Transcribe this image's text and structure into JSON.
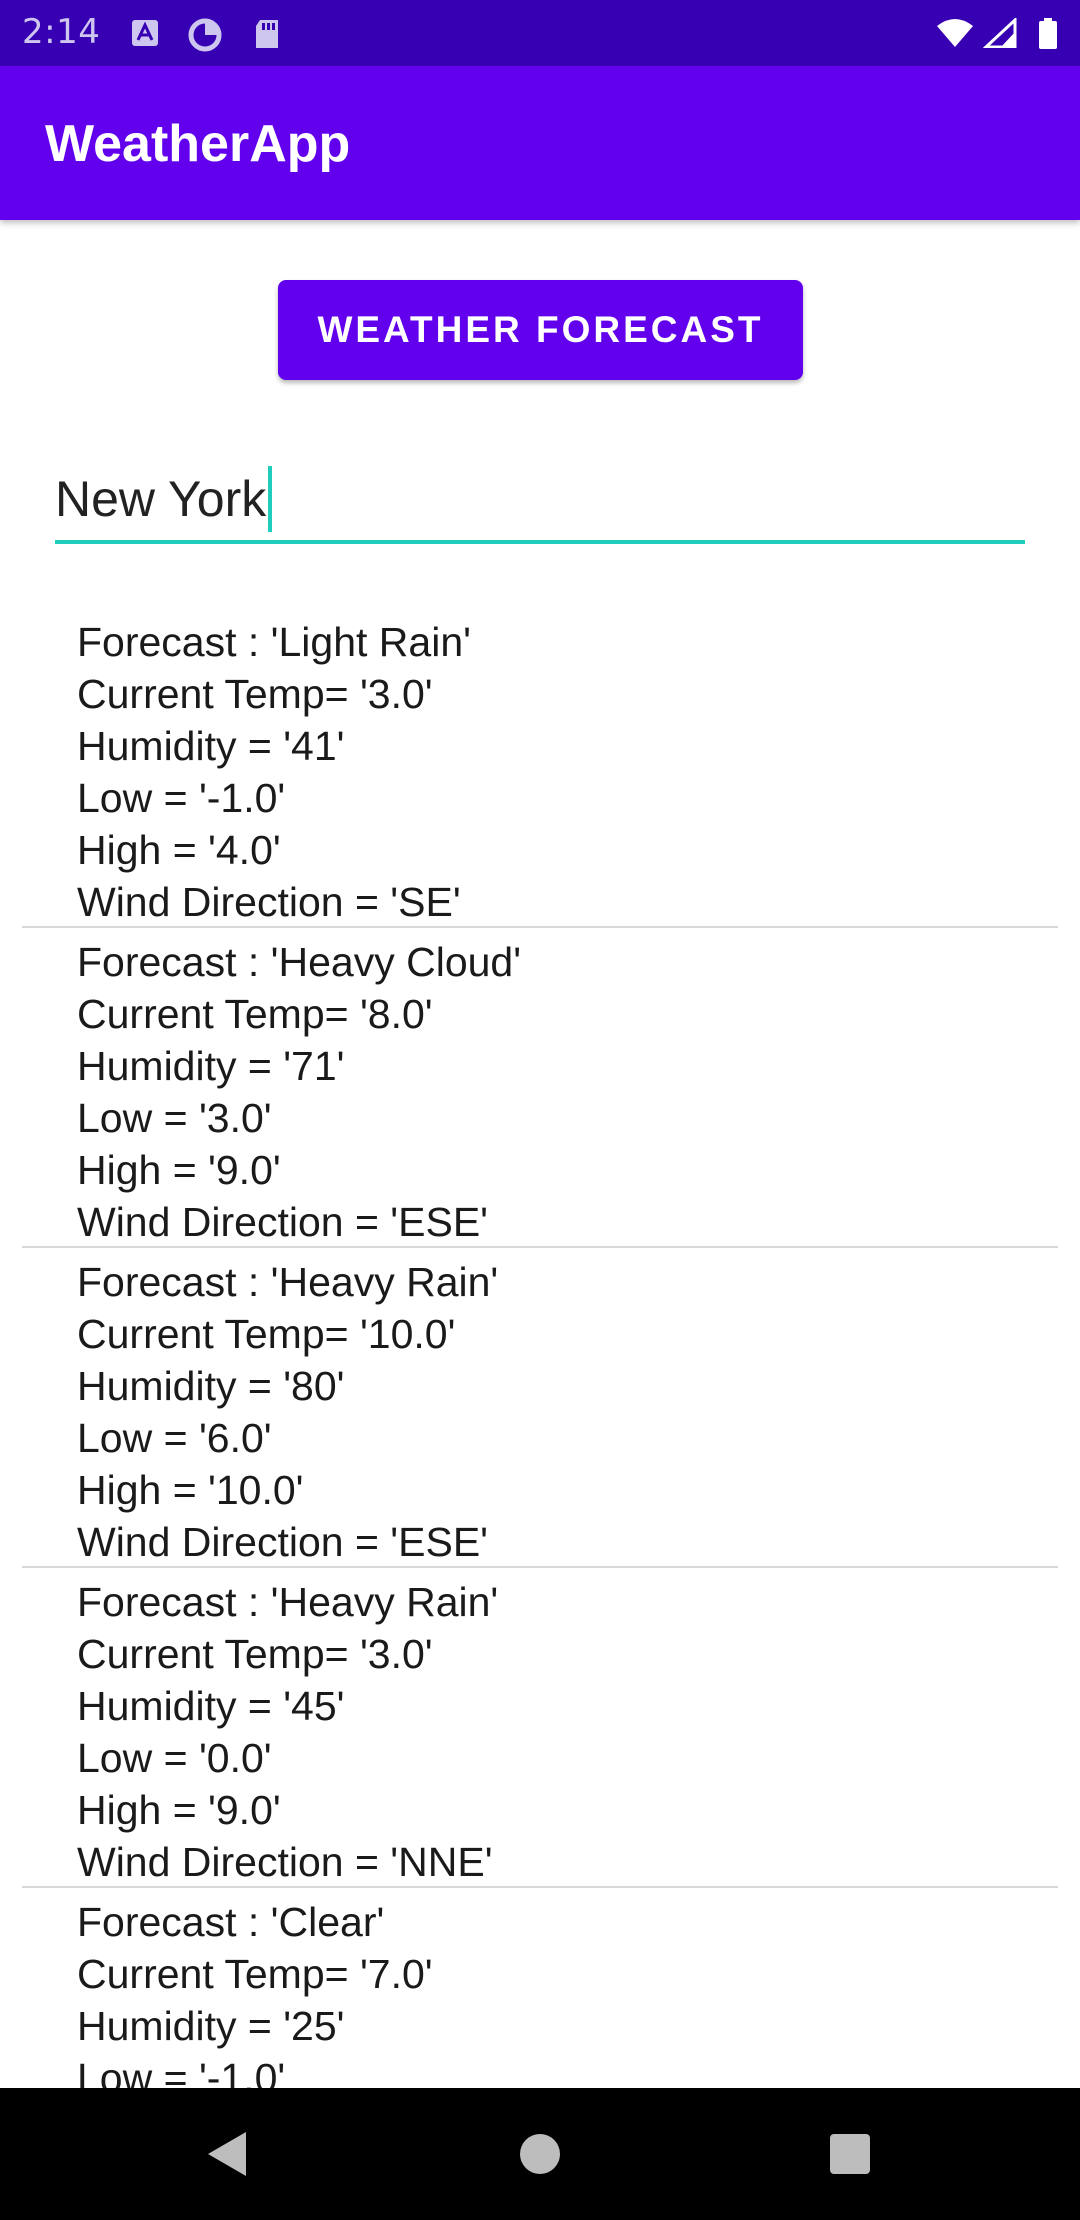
{
  "status_bar": {
    "time": "2:14",
    "icons": [
      "autofill-icon",
      "data-saver-icon",
      "sd-card-icon",
      "wifi-icon",
      "signal-icon",
      "battery-icon"
    ]
  },
  "app_bar": {
    "title": "WeatherApp"
  },
  "forecast_button": {
    "label": "WEATHER FORECAST"
  },
  "city_input": {
    "value": "New York"
  },
  "forecasts": [
    {
      "forecast": "Forecast : 'Light Rain'",
      "current_temp": "Current Temp= '3.0'",
      "humidity": "Humidity = '41'",
      "low": "Low = '-1.0'",
      "high": "High = '4.0'",
      "wind": "Wind Direction = 'SE'"
    },
    {
      "forecast": "Forecast : 'Heavy Cloud'",
      "current_temp": "Current Temp= '8.0'",
      "humidity": "Humidity = '71'",
      "low": "Low = '3.0'",
      "high": "High = '9.0'",
      "wind": "Wind Direction = 'ESE'"
    },
    {
      "forecast": "Forecast : 'Heavy Rain'",
      "current_temp": "Current Temp= '10.0'",
      "humidity": "Humidity = '80'",
      "low": "Low = '6.0'",
      "high": "High = '10.0'",
      "wind": "Wind Direction = 'ESE'"
    },
    {
      "forecast": "Forecast : 'Heavy Rain'",
      "current_temp": "Current Temp= '3.0'",
      "humidity": "Humidity = '45'",
      "low": "Low = '0.0'",
      "high": "High = '9.0'",
      "wind": "Wind Direction = 'NNE'"
    },
    {
      "forecast": "Forecast : 'Clear'",
      "current_temp": "Current Temp= '7.0'",
      "humidity": "Humidity = '25'",
      "low": "Low = '-1.0'",
      "high": "",
      "wind": ""
    }
  ],
  "nav_bar": {
    "icons": [
      "back-icon",
      "home-icon",
      "recents-icon"
    ]
  },
  "colors": {
    "status_bar": "#3700b3",
    "primary": "#6200ee",
    "accent": "#1fcdbd",
    "divider": "#d8d8d8"
  }
}
